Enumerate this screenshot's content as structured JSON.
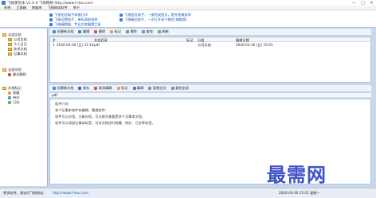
{
  "window": {
    "title": "飞扬便签本 V1.0.0  飞扬网络  http://www.f-dou.com",
    "buttons": [
      "—",
      "□",
      "✕"
    ]
  },
  "menu": [
    "系统",
    "工具箱",
    "数据库",
    "飞扬网站软件",
    "关于"
  ],
  "ads": [
    {
      "text": "飞扬无忧电子表格打印",
      "color": "#1556b8"
    },
    {
      "text": "飞扬话费助手，单机获取秘钥",
      "color": "#1556b8"
    },
    {
      "text": "飞扬编辑器，专业文本编辑工具",
      "color": "#1556b8"
    },
    {
      "text": "飞扬图文助手，一键完成图文，提升图像效率",
      "color": "#1556b8"
    },
    {
      "text": "飞扬微信助手，一次打开多个微信(电脑版)",
      "color": "#1556b8"
    }
  ],
  "sidebar": {
    "groups": [
      {
        "label": "全部文档",
        "children": [
          "公司文档",
          "个人日记",
          "技术文档",
          "记事文档"
        ]
      },
      {
        "label": "全部文档",
        "children": [
          "最近删除"
        ]
      },
      {
        "label": "文档标记",
        "children": [
          "收藏",
          "待办",
          "已办"
        ]
      }
    ]
  },
  "top_toolbar": [
    "创建新文档",
    "编辑",
    "删除",
    "标记",
    "属性",
    "查找",
    "刷新"
  ],
  "list": {
    "columns": [
      "#",
      "文档目录",
      "标记",
      "分组",
      "编辑日期"
    ],
    "rows": [
      {
        "num": "1",
        "date_created": "2020-03-30 (日) 21:10",
        "name": "pdf",
        "group": "公司文档",
        "edit_date": "2020-03-30 (日) 15:01"
      }
    ]
  },
  "detail_toolbar": [
    "创建新文档",
    "保存",
    "取消编辑",
    "标记",
    "编辑",
    "复制全文",
    "复制全部"
  ],
  "doc_path": "pdf",
  "editor": {
    "lines": [
      "软件介绍",
      "本个记事本软件有编辑、整理软件：",
      "软件可以分组、三级分组，可以按天查看是多个记事本文档；",
      "软件可以添加记事本标签，可对文档进行收藏、待办、已办等标签。"
    ]
  },
  "status": {
    "left": "更多软件，请访问飞扬网站：",
    "url": "http://www.f-dou.com",
    "right": "2020-03-30 15:01 星期一"
  },
  "watermark": "最需网"
}
